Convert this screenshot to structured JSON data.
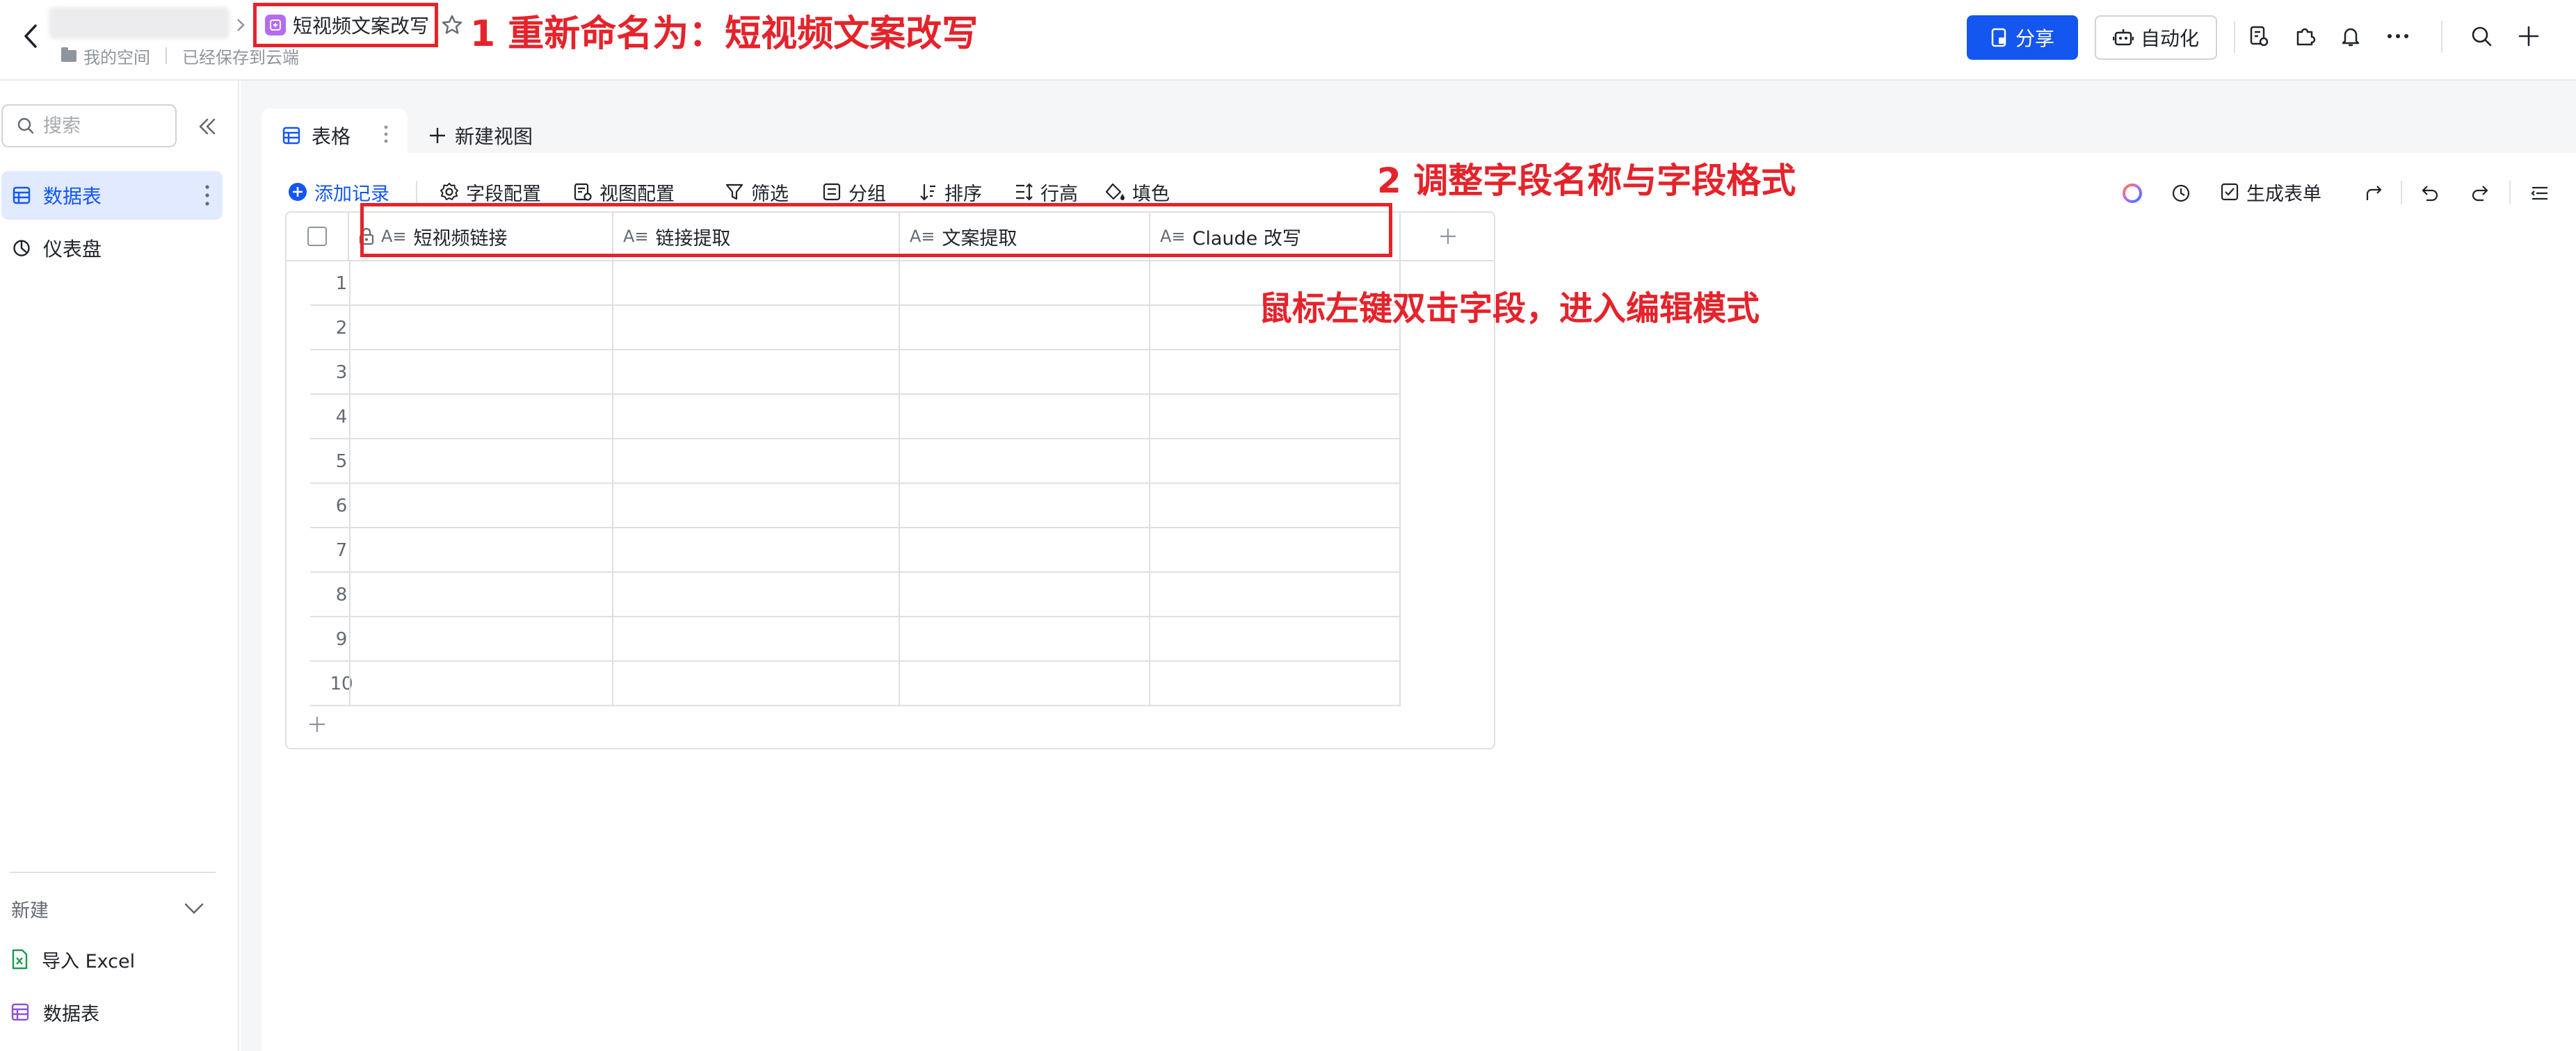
{
  "topbar": {
    "space_label": "我的空间",
    "save_status": "已经保存到云端",
    "doc_title": "短视频文案改写",
    "share_label": "分享",
    "automation_label": "自动化"
  },
  "annotations": {
    "step1": "1 重新命名为：短视频文案改写",
    "step2": "2 调整字段名称与字段格式",
    "hint": "鼠标左键双击字段，进入编辑模式"
  },
  "sidebar": {
    "search_placeholder": "搜索",
    "items": [
      {
        "label": "数据表",
        "icon": "table-icon",
        "active": true
      },
      {
        "label": "仪表盘",
        "icon": "dashboard-icon",
        "active": false
      }
    ],
    "new_label": "新建",
    "footer": [
      {
        "label": "导入 Excel",
        "icon": "excel-icon"
      },
      {
        "label": "数据表",
        "icon": "table-icon"
      }
    ]
  },
  "tabs": {
    "active_label": "表格",
    "new_view_label": "新建视图"
  },
  "toolbar": {
    "add_record": "添加记录",
    "field_config": "字段配置",
    "view_config": "视图配置",
    "filter": "筛选",
    "group": "分组",
    "sort": "排序",
    "row_height": "行高",
    "fill_color": "填色",
    "generate_form": "生成表单"
  },
  "table": {
    "columns": [
      {
        "name": "短视频链接",
        "type": "A≡",
        "locked": true
      },
      {
        "name": "链接提取",
        "type": "A≡",
        "locked": false
      },
      {
        "name": "文案提取",
        "type": "A≡",
        "locked": false
      },
      {
        "name": "Claude 改写",
        "type": "A≡",
        "locked": false
      }
    ],
    "rows": [
      "1",
      "2",
      "3",
      "4",
      "5",
      "6",
      "7",
      "8",
      "9",
      "10"
    ]
  },
  "colors": {
    "accent": "#1456f0",
    "annotation": "#e5232b",
    "doc_icon": "#b56cf0"
  }
}
